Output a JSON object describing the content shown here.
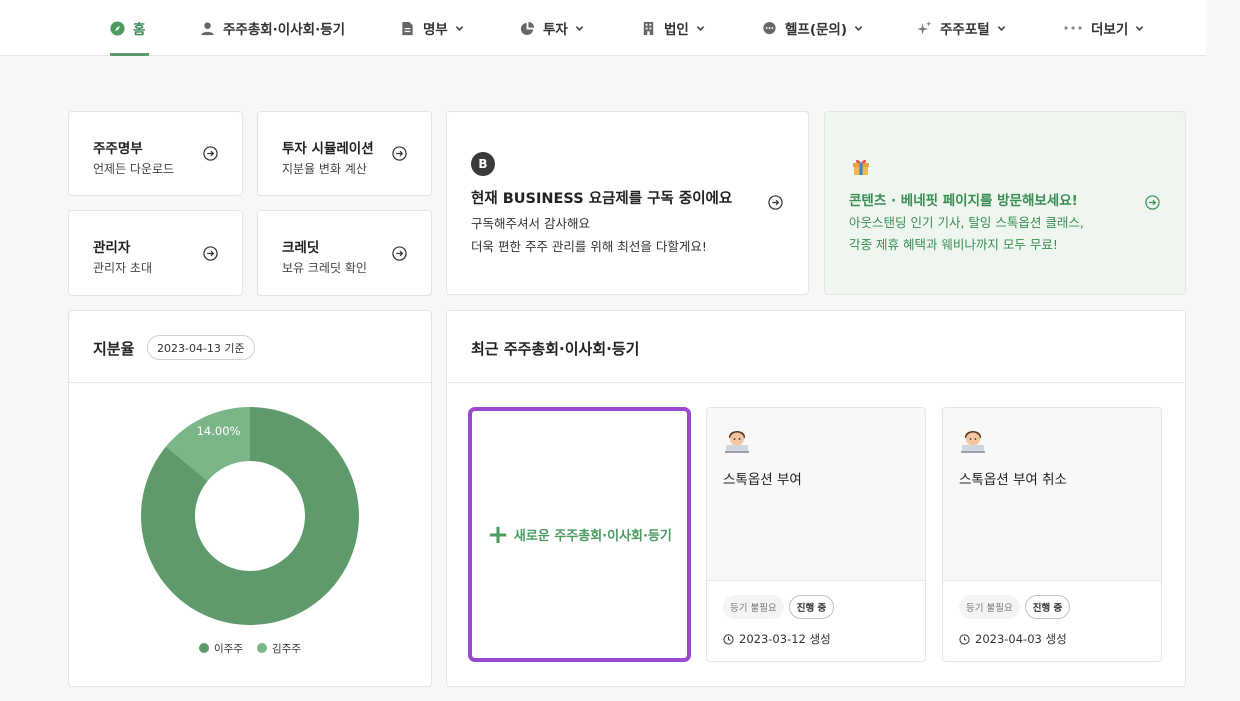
{
  "nav": {
    "items": [
      {
        "label": "홈",
        "icon": "compass-icon"
      },
      {
        "label": "주주총회·이사회·등기",
        "icon": "person-icon"
      },
      {
        "label": "명부",
        "icon": "document-icon"
      },
      {
        "label": "투자",
        "icon": "pie-chart-icon"
      },
      {
        "label": "법인",
        "icon": "building-icon"
      },
      {
        "label": "헬프(문의)",
        "icon": "chat-bubble-icon"
      },
      {
        "label": "주주포털",
        "icon": "sparkle-icon"
      },
      {
        "label": "더보기",
        "icon": "more-dots-icon"
      }
    ]
  },
  "quick_links": [
    {
      "title": "주주명부",
      "sub": "언제든 다운로드"
    },
    {
      "title": "투자 시뮬레이션",
      "sub": "지분율 변화 계산"
    },
    {
      "title": "관리자",
      "sub": "관리자 초대"
    },
    {
      "title": "크레딧",
      "sub": "보유 크레딧 확인"
    }
  ],
  "business": {
    "badge": "B",
    "title": "현재 BUSINESS 요금제를 구독 중이에요",
    "line1": "구독해주셔서 감사해요",
    "line2": "더욱 편한 주주 관리를 위해 최선을 다할게요!"
  },
  "promo": {
    "title": "콘텐츠 · 베네핏 페이지를 방문해보세요!",
    "line1": "아웃스탠딩 인기 기사, 탈잉 스톡옵션 클래스,",
    "line2": "각종 제휴 혜택과 웨비나까지 모두 무료!"
  },
  "equity": {
    "title": "지분율",
    "date_badge": "2023-04-13 기준"
  },
  "chart_data": {
    "type": "pie",
    "donut": true,
    "series": [
      {
        "name": "이주주",
        "value": 86.0,
        "label": "86.00%",
        "color": "#5e9a6c"
      },
      {
        "name": "김주주",
        "value": 14.0,
        "label": "14.00%",
        "color": "#7ab687"
      }
    ],
    "legend": "bottom"
  },
  "meetings": {
    "title": "최근 주주총회·이사회·등기",
    "new_label": "새로운 주주총회·이사회·등기",
    "new_plus": "+",
    "items": [
      {
        "title": "스톡옵션 부여",
        "badge_grey": "등기 불필요",
        "badge_status": "진행 중",
        "date": "2023-03-12 생성"
      },
      {
        "title": "스톡옵션 부여 취소",
        "badge_grey": "등기 불필요",
        "badge_status": "진행 중",
        "date": "2023-04-03 생성"
      }
    ]
  }
}
